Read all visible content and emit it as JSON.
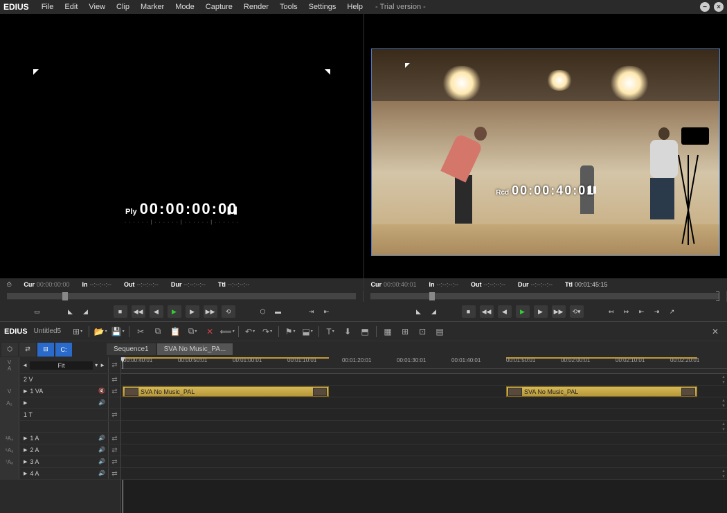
{
  "app": {
    "name": "EDIUS",
    "trial_label": "- Trial version -"
  },
  "menu": [
    "File",
    "Edit",
    "View",
    "Clip",
    "Marker",
    "Mode",
    "Capture",
    "Render",
    "Tools",
    "Settings",
    "Help"
  ],
  "source_monitor": {
    "tc_label": "Ply",
    "tc_value": "00:00:00:00",
    "cur_label": "Cur",
    "cur_value": "00:00:00:00",
    "in_label": "In",
    "in_value": "--:--:--:--",
    "out_label": "Out",
    "out_value": "--:--:--:--",
    "dur_label": "Dur",
    "dur_value": "--:--:--:--",
    "ttl_label": "Ttl",
    "ttl_value": "--:--:--:--"
  },
  "record_monitor": {
    "tc_label": "Rcd",
    "tc_value": "00:00:40:01",
    "cur_label": "Cur",
    "cur_value": "00:00:40:01",
    "in_label": "In",
    "in_value": "--:--:--:--",
    "out_label": "Out",
    "out_value": "--:--:--:--",
    "dur_label": "Dur",
    "dur_value": "--:--:--:--",
    "ttl_label": "Ttl",
    "ttl_value": "00:01:45:15"
  },
  "project": {
    "name": "Untitled5"
  },
  "sequence_tabs": [
    {
      "label": "Sequence1",
      "active": false
    },
    {
      "label": "SVA No Music_PA...",
      "active": true
    }
  ],
  "zoom": {
    "value": "Fit"
  },
  "ruler_ticks": [
    "00:00:40:01",
    "00:00:50:01",
    "00:01:00:01",
    "00:01:10:01",
    "00:01:20:01",
    "00:01:30:01",
    "00:01:40:01",
    "00:01:50:01",
    "00:02:00:01",
    "00:02:10:01",
    "00:02:20:01"
  ],
  "tracks": {
    "v2": "2 V",
    "va1": "1 VA",
    "t1": "1 T",
    "a1": "1 A",
    "a2": "2 A",
    "a3": "3 A",
    "a4": "4 A"
  },
  "track_labels_left": {
    "v_top": "V",
    "a_top": "A",
    "v_main": "V",
    "a2_sub": "A₂",
    "a34": "³A₄",
    "a56": "⁵A₆",
    "a78": "⁷A₈"
  },
  "clips": {
    "clip1": "SVA No Music_PAL",
    "clip2": "SVA No Music_PAL"
  }
}
